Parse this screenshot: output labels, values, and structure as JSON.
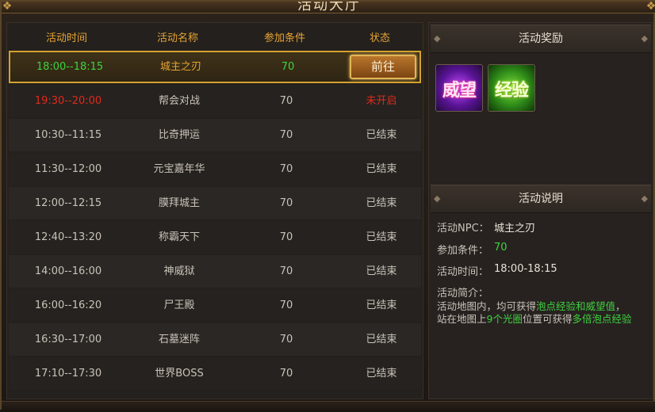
{
  "window": {
    "title": "活动大厅"
  },
  "table": {
    "headers": [
      "活动时间",
      "活动名称",
      "参加条件",
      "状态"
    ],
    "rows": [
      {
        "time": "18:00--18:15",
        "name": "城主之刃",
        "level": "70",
        "status": "前往",
        "state": "active"
      },
      {
        "time": "19:30--20:00",
        "name": "帮会对战",
        "level": "70",
        "status": "未开启",
        "state": "pending"
      },
      {
        "time": "10:30--11:15",
        "name": "比奇押运",
        "level": "70",
        "status": "已结束",
        "state": "ended"
      },
      {
        "time": "11:30--12:00",
        "name": "元宝嘉年华",
        "level": "70",
        "status": "已结束",
        "state": "ended"
      },
      {
        "time": "12:00--12:15",
        "name": "膜拜城主",
        "level": "70",
        "status": "已结束",
        "state": "ended"
      },
      {
        "time": "12:40--13:20",
        "name": "称霸天下",
        "level": "70",
        "status": "已结束",
        "state": "ended"
      },
      {
        "time": "14:00--16:00",
        "name": "神威狱",
        "level": "70",
        "status": "已结束",
        "state": "ended"
      },
      {
        "time": "16:00--16:20",
        "name": "尸王殿",
        "level": "70",
        "status": "已结束",
        "state": "ended"
      },
      {
        "time": "16:30--17:00",
        "name": "石墓迷阵",
        "level": "70",
        "status": "已结束",
        "state": "ended"
      },
      {
        "time": "17:10--17:30",
        "name": "世界BOSS",
        "level": "70",
        "status": "已结束",
        "state": "ended"
      }
    ]
  },
  "rewards": {
    "title": "活动奖励",
    "items": [
      {
        "label": "威望",
        "icon": "prestige-icon"
      },
      {
        "label": "经验",
        "icon": "experience-icon"
      }
    ]
  },
  "info": {
    "title": "活动说明",
    "npc_label": "活动NPC：",
    "npc_value": "城主之刃",
    "req_label": "参加条件：",
    "req_value": "70",
    "time_label": "活动时间：",
    "time_value": "18:00-18:15",
    "intro_label": "活动简介：",
    "desc_1": "活动地图内，均可获得",
    "desc_hl_1": "泡点经验和威望值",
    "desc_2": "，站在地图上",
    "desc_hl_2": "9个光圈",
    "desc_3": "位置可获得",
    "desc_hl_3": "多倍泡点经验"
  },
  "colors": {
    "header_gold": "#e6a433",
    "active_green": "#3fd23f",
    "pending_red": "#e02a1e",
    "ended_gray": "#c9c3b9"
  }
}
